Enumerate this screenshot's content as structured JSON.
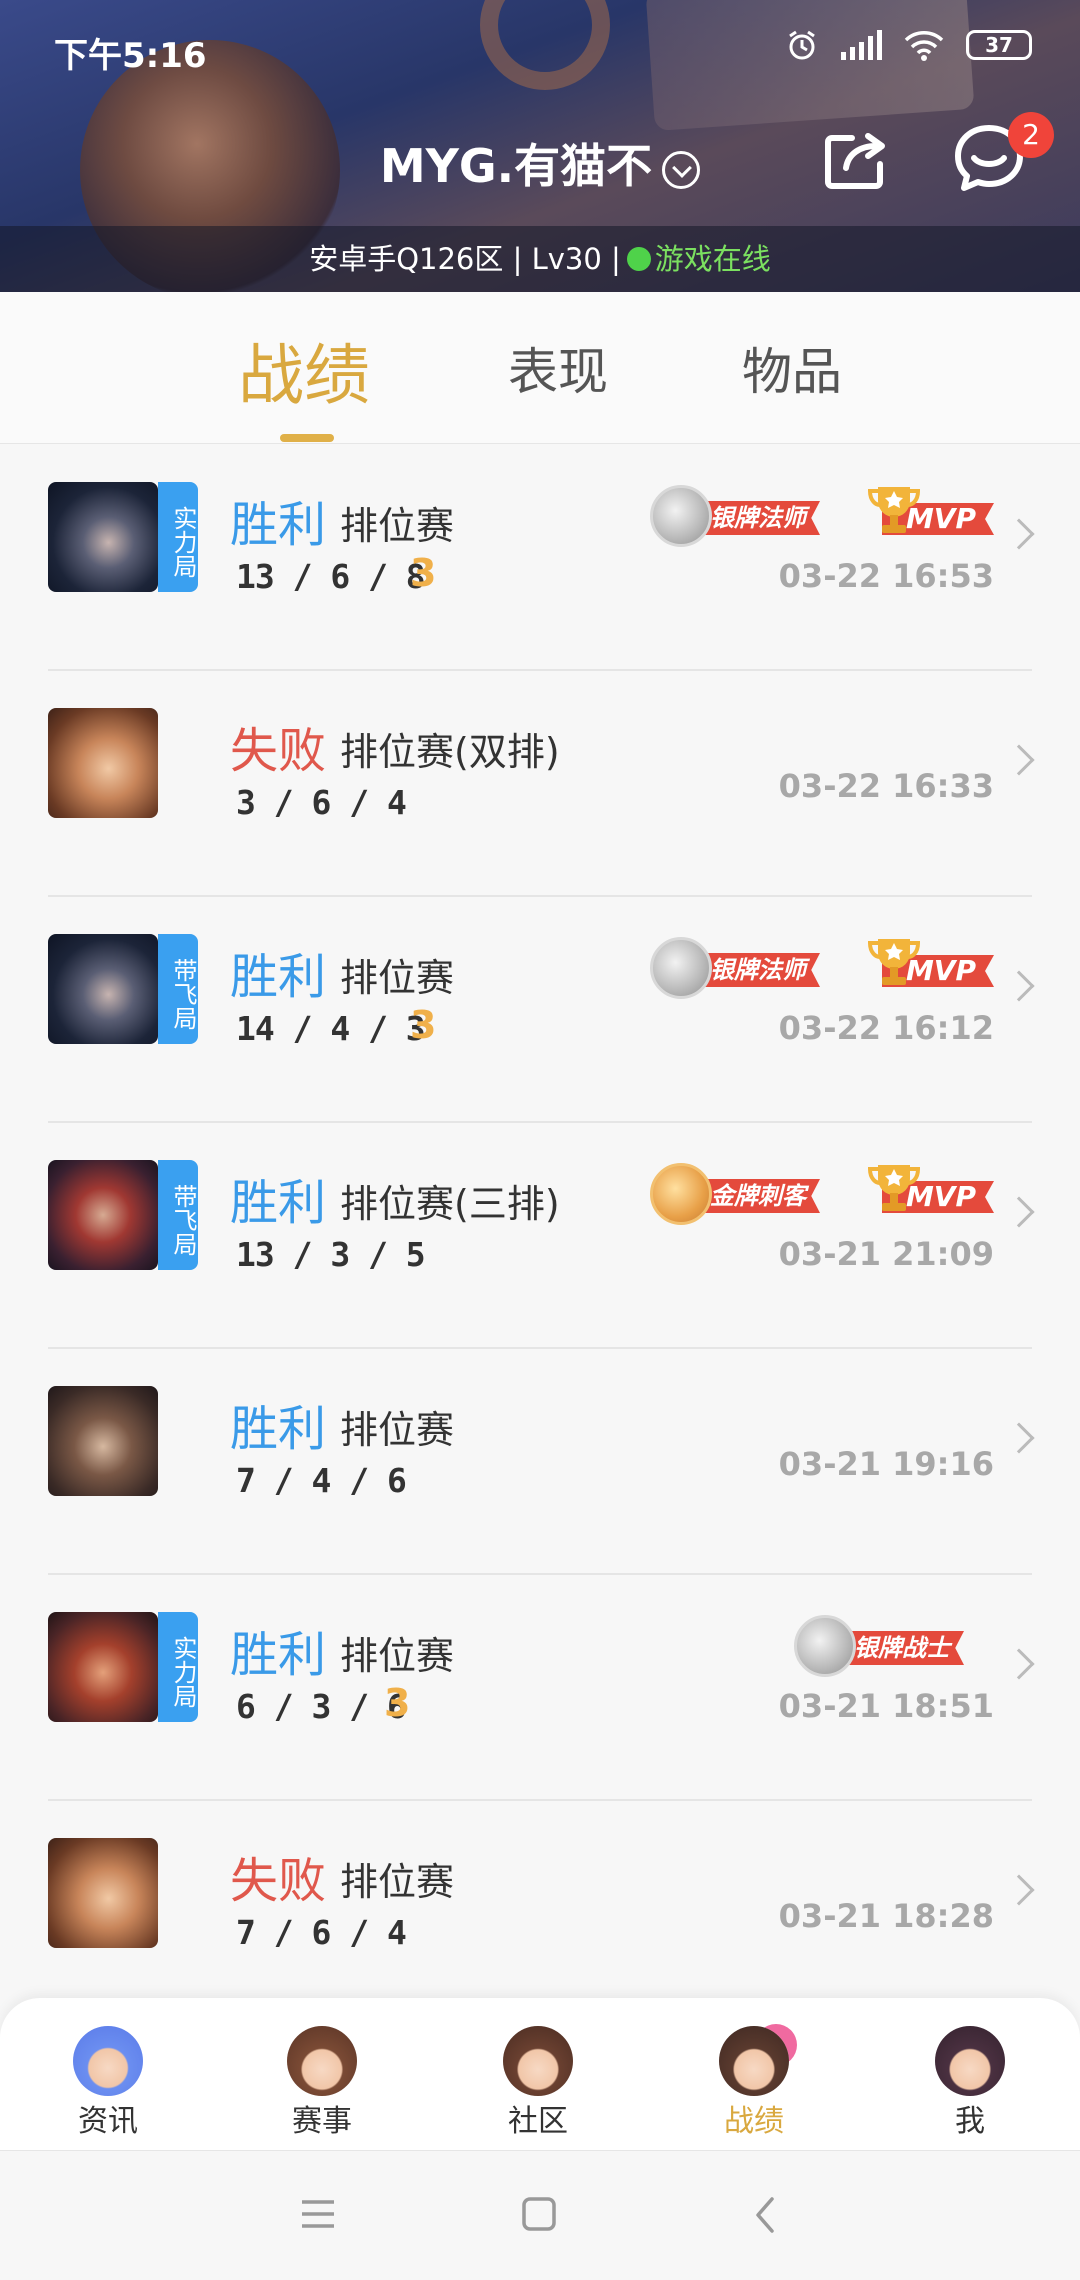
{
  "status_bar": {
    "time": "下午5:16",
    "battery": "37"
  },
  "header": {
    "username": "MYG.有猫不",
    "message_badge": "2",
    "server_info": "安卓手Q126区 | Lv30 |",
    "online_text": "游戏在线"
  },
  "tabs": [
    {
      "label": "战绩",
      "active": true
    },
    {
      "label": "表现",
      "active": false
    },
    {
      "label": "物品",
      "active": false
    }
  ],
  "matches": [
    {
      "tag": "实力局",
      "result": "胜利",
      "mode": "排位赛",
      "kda": "13 / 6 / 8",
      "triple": "3",
      "badges": [
        "银牌法师",
        "MVP"
      ],
      "time": "03-22 16:53"
    },
    {
      "tag": "",
      "result": "失败",
      "mode": "排位赛(双排)",
      "kda": "3 / 6 / 4",
      "triple": "",
      "badges": [],
      "time": "03-22 16:33"
    },
    {
      "tag": "带飞局",
      "result": "胜利",
      "mode": "排位赛",
      "kda": "14 / 4 / 3",
      "triple": "3",
      "badges": [
        "银牌法师",
        "MVP"
      ],
      "time": "03-22 16:12"
    },
    {
      "tag": "带飞局",
      "result": "胜利",
      "mode": "排位赛(三排)",
      "kda": "13 / 3 / 5",
      "triple": "",
      "badges": [
        "金牌刺客",
        "MVP"
      ],
      "time": "03-21 21:09"
    },
    {
      "tag": "",
      "result": "胜利",
      "mode": "排位赛",
      "kda": "7 / 4 / 6",
      "triple": "",
      "badges": [],
      "time": "03-21 19:16"
    },
    {
      "tag": "实力局",
      "result": "胜利",
      "mode": "排位赛",
      "kda": "6 / 3 / 6",
      "triple": "3",
      "badges": [
        "银牌战士"
      ],
      "time": "03-21 18:51"
    },
    {
      "tag": "",
      "result": "失败",
      "mode": "排位赛",
      "kda": "7 / 6 / 4",
      "triple": "",
      "badges": [],
      "time": "03-21 18:28"
    }
  ],
  "bottom_nav": [
    {
      "label": "资讯",
      "active": false
    },
    {
      "label": "赛事",
      "active": false
    },
    {
      "label": "社区",
      "active": false
    },
    {
      "label": "战绩",
      "active": true
    },
    {
      "label": "我",
      "active": false
    }
  ],
  "colors": {
    "accent": "#d9a83f",
    "win": "#3a9ae8",
    "lose": "#e0584c",
    "tag": "#3aa0f0",
    "ribbon": "#e44a3c"
  }
}
